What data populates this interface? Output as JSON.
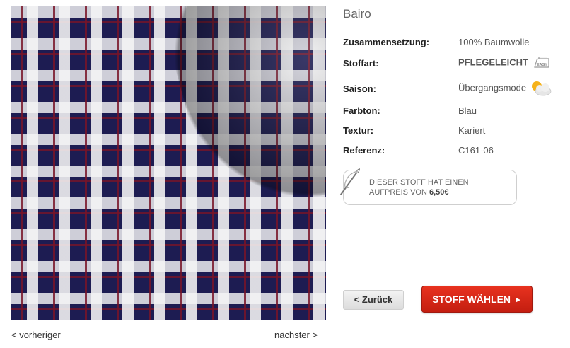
{
  "product": {
    "title": "Bairo"
  },
  "attributes": [
    {
      "label": "Zusammensetzung:",
      "value": "100% Baumwolle"
    },
    {
      "label": "Stoffart:",
      "value": "PFLEGELEICHT"
    },
    {
      "label": "Saison:",
      "value": "Übergangsmode"
    },
    {
      "label": "Farbton:",
      "value": "Blau"
    },
    {
      "label": "Textur:",
      "value": "Kariert"
    },
    {
      "label": "Referenz:",
      "value": "C161-06"
    }
  ],
  "icons": {
    "easy_care": "easy-care-iron-icon",
    "easy_label": "EASY",
    "season": "sun-cloud-icon",
    "surcharge": "needle-thread-icon"
  },
  "surcharge": {
    "line1": "DIESER STOFF HAT EINEN",
    "line2_prefix": "AUFPREIS VON ",
    "price": "6,50€"
  },
  "buttons": {
    "back": "< Zurück",
    "choose": "STOFF WÄHLEN",
    "choose_arrow": "►"
  },
  "navigation": {
    "previous": "< vorheriger",
    "next": "nächster >"
  },
  "colors": {
    "accent_red": "#d6281a",
    "fabric_navy": "#1d1c52",
    "fabric_burgundy": "#78142a"
  }
}
